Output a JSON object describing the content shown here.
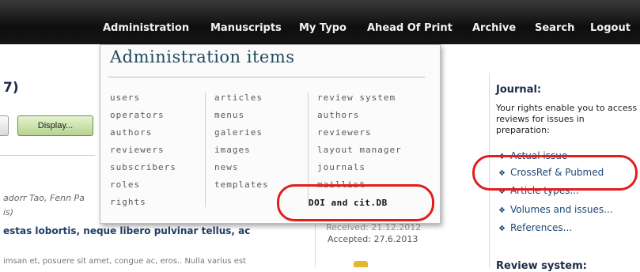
{
  "nav": {
    "items": [
      "Administration",
      "Manuscripts",
      "My Typo",
      "Ahead Of Print",
      "Archive",
      "Search",
      "Logout"
    ]
  },
  "page": {
    "title_fragment": "7)",
    "display_button": "Display...",
    "authors_fragment": "adorr Tao, Fenn Pa",
    "authors_fragment2": "is)",
    "article_title": "estas lobortis, neque libero pulvinar tellus, ac",
    "abstract_fragment": "imsan et, posuere sit amet, congue ac, eros.. Nulla varius est",
    "received": "Received: 21.12.2012",
    "accepted": "Accepted: 27.6.2013"
  },
  "dropdown": {
    "title": "Administration items",
    "col1": [
      "users",
      "operators",
      "authors",
      "reviewers",
      "subscribers",
      "roles",
      "rights"
    ],
    "col2": [
      "articles",
      "menus",
      "galeries",
      "images",
      "news",
      "templates"
    ],
    "col3": [
      "review system",
      "authors",
      "reviewers",
      "layout manager",
      "journals",
      "maillist"
    ],
    "doi_item": "DOI and cit.DB"
  },
  "sidebar": {
    "journal_title": "Journal:",
    "rights_text": "Your rights enable you to access reviews for issues in preparation:",
    "links": [
      "Actual issue",
      "CrossRef & Pubmed",
      "Article types...",
      "Volumes and issues...",
      "References..."
    ],
    "bullet": "❖",
    "review_title": "Review system:"
  },
  "colors": {
    "annotation": "#e21d1d",
    "nav_bg": "#111111",
    "link": "#1d4677"
  }
}
